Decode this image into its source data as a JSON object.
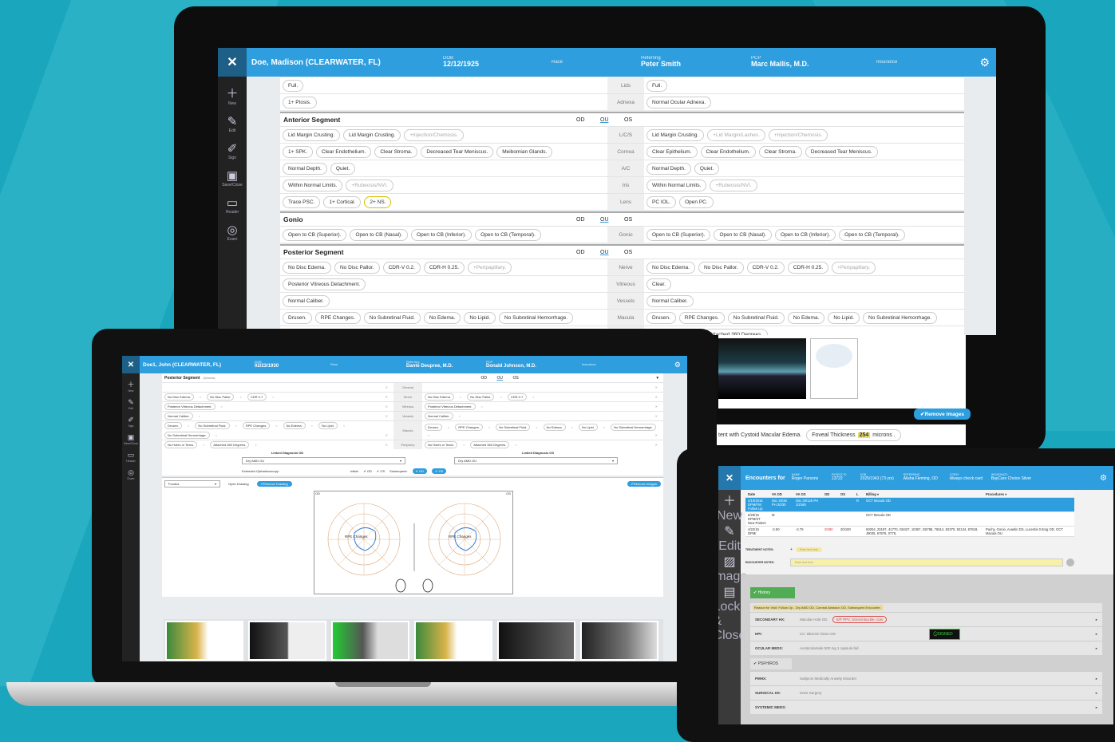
{
  "monitor": {
    "header": {
      "patient": "Doe, Madison (CLEARWATER, FL)",
      "dob_label": "DOB",
      "dob": "12/12/1925",
      "race_label": "Race",
      "referring_label": "Referring",
      "referring": "Peter Smith",
      "pcp_label": "PCP",
      "pcp": "Marc Mallis, M.D.",
      "insurance_label": "Insurance"
    },
    "sidebar": [
      {
        "label": "New",
        "icon": "plus-icon"
      },
      {
        "label": "Edit",
        "icon": "edit-icon"
      },
      {
        "label": "Sign",
        "icon": "pen-icon"
      },
      {
        "label": "Save/Close",
        "icon": "save-close-icon"
      },
      {
        "label": "Header",
        "icon": "monitor-icon"
      },
      {
        "label": "Exam",
        "icon": "compass-icon"
      }
    ],
    "top_rows": [
      {
        "left": [
          "Full."
        ],
        "mid": "Lids",
        "right": [
          "Full."
        ]
      },
      {
        "left": [
          "1+ Ptosis."
        ],
        "mid": "Adnexa",
        "right": [
          "Normal Ocular Adnexa."
        ]
      }
    ],
    "anterior": {
      "title": "Anterior Segment",
      "od": "OD",
      "ou": "OU",
      "os": "OS",
      "rows": [
        {
          "left": [
            "Lid Margin Crusting.",
            "Lid Margin Crusting.",
            "+Injection/Chemosis."
          ],
          "mid": "L/C/S",
          "right": [
            "Lid Margin Crusting.",
            "+Lid Margin/Lashes.",
            "+Injection/Chemosis."
          ]
        },
        {
          "left": [
            "1+ SPK.",
            "Clear Endothelium.",
            "Clear Stroma.",
            "Decreased Tear Meniscus.",
            "Meibomian Glands."
          ],
          "mid": "Cornea",
          "right": [
            "Clear Epithelium.",
            "Clear Endothelium.",
            "Clear Stroma.",
            "Decreased Tear Meniscus."
          ]
        },
        {
          "left": [
            "Normal Depth.",
            "Quiet."
          ],
          "mid": "A/C",
          "right": [
            "Normal Depth.",
            "Quiet."
          ]
        },
        {
          "left": [
            "Within Normal Limits.",
            "+Rubeosis/NVI."
          ],
          "mid": "Iris",
          "right": [
            "Within Normal Limits.",
            "+Rubeosis/NVI."
          ]
        },
        {
          "left": [
            "Trace PSC.",
            "1+ Cortical.",
            "2+ NS."
          ],
          "mid": "Lens",
          "right": [
            "PC IOL.",
            "Open PC."
          ]
        }
      ]
    },
    "gonio": {
      "title": "Gonio",
      "od": "OD",
      "ou": "OU",
      "os": "OS",
      "rows": [
        {
          "left": [
            "Open to CB (Superior).",
            "Open to CB (Nasal).",
            "Open to CB (Inferior).",
            "Open to CB (Temporal)."
          ],
          "mid": "Gonio",
          "right": [
            "Open to CB (Superior).",
            "Open to CB (Nasal).",
            "Open to CB (Inferior).",
            "Open to CB (Temporal)."
          ]
        }
      ]
    },
    "posterior": {
      "title": "Posterior Segment",
      "od": "OD",
      "ou": "OU",
      "os": "OS",
      "rows": [
        {
          "left": [
            "No Disc Edema.",
            "No Disc Pallor.",
            "CDR-V 0.2.",
            "CDR-H 0.25.",
            "+Peripapillary."
          ],
          "mid": "Nerve",
          "right": [
            "No Disc Edema.",
            "No Disc Pallor.",
            "CDR-V 0.2.",
            "CDR-H 0.25.",
            "+Peripapillary."
          ]
        },
        {
          "left": [
            "Posterior Vitreous Detachment."
          ],
          "mid": "Vitreous",
          "right": [
            "Clear."
          ]
        },
        {
          "left": [
            "Normal Caliber."
          ],
          "mid": "Vessels",
          "right": [
            "Normal Caliber."
          ]
        },
        {
          "left": [
            "Drusen.",
            "RPE Changes.",
            "No Subretinal Fluid.",
            "No Edema.",
            "No Lipid.",
            "No Subretinal Hemorrhage."
          ],
          "mid": "Macula",
          "right": [
            "Drusen.",
            "RPE Changes.",
            "No Subretinal Fluid.",
            "No Edema.",
            "No Lipid.",
            "No Subretinal Hemorrhage."
          ]
        },
        {
          "left": [
            "No Holes or Tears.",
            "Attached 360 Degrees."
          ],
          "mid": "Periphery",
          "right": [
            "No Holes or Tears.",
            "Attached 360 Degrees."
          ]
        }
      ]
    },
    "remove_images": "✔Remove Images",
    "diagnosis_text": "tent with Cystoid Macular Edema.",
    "foveal_label": "Foveal Thickness",
    "foveal_value": "254",
    "foveal_unit": "microns ."
  },
  "laptop": {
    "header": {
      "patient": "Doe1, John (CLEARWATER, FL)",
      "dob_label": "DOB",
      "dob": "02/23/1930",
      "race_label": "Race",
      "referring_label": "Referring",
      "referring": "Dante Deupree, M.D.",
      "pcp_label": "PCP",
      "pcp": "Donald Johnson, M.D.",
      "insurance_label": "Insurance"
    },
    "sidebar": [
      {
        "label": "New",
        "icon": "plus-icon"
      },
      {
        "label": "Edit",
        "icon": "edit-icon"
      },
      {
        "label": "Sign",
        "icon": "pen-icon"
      },
      {
        "label": "Save/Close",
        "icon": "save-close-icon"
      },
      {
        "label": "Header",
        "icon": "monitor-icon"
      },
      {
        "label": "Exam",
        "icon": "compass-icon"
      }
    ],
    "posterior": {
      "title": "Posterior Segment",
      "defaults": "(Defaults)",
      "od": "OD",
      "ou": "OU",
      "os": "OS",
      "rows": [
        {
          "left": [],
          "mid": "General",
          "right": []
        },
        {
          "left": [
            "No Disc Edema.",
            "No Disc Pallor.",
            "CDR 0.7."
          ],
          "mid": "Nerve",
          "right": [
            "No Disc Edema.",
            "No Disc Pallor.",
            "CDR 0.7."
          ]
        },
        {
          "left": [
            "Posterior Vitreous Detachment."
          ],
          "mid": "Vitreous",
          "right": [
            "Posterior Vitreous Detachment."
          ]
        },
        {
          "left": [
            "Normal Caliber."
          ],
          "mid": "Vessels",
          "right": [
            "Normal Caliber."
          ]
        },
        {
          "left": [
            "Drusen.",
            "No Subretinal Fluid.",
            "RPE Changes.",
            "No Edema.",
            "No Lipid.",
            "No Subretinal Hemorrhage."
          ],
          "mid": "Macula",
          "right": [
            "Drusen.",
            "RPE Changes.",
            "No Subretinal Fluid.",
            "No Edema.",
            "No Lipid.",
            "No Subretinal Hemorrhage."
          ]
        },
        {
          "left": [
            "No Holes or Tears.",
            "Attached 360 Degrees."
          ],
          "mid": "Periphery",
          "right": [
            "No Holes or Tears.",
            "Attached 360 Degrees."
          ]
        }
      ]
    },
    "linked_od_label": "Linked Diagnosis OD",
    "linked_os_label": "Linked Diagnosis OS",
    "linked_od": "Dry AMD OU",
    "linked_os": "Dry AMD OU",
    "extended_label": "Extended Opthalmoscopy:",
    "initial_label": "Initial:",
    "initial_od": "✔ OD",
    "initial_os": "✔ OS",
    "subsequent_label": "Subsequent:",
    "sub_od": "✔ OD",
    "sub_os": "✔ OS",
    "drawing_select": "Fundus",
    "open_drawing": "Open Drawing",
    "remove_drawing": "✔Remove Drawing",
    "remove_images": "✔Remove Images",
    "od_tag": "OD",
    "os_tag": "OS",
    "annot_od": "RPE Changes",
    "annot_os": "RPE Changes"
  },
  "tablet": {
    "header": {
      "title": "Encounters for",
      "name_label": "NAME",
      "name": "Roger Parsons",
      "pid_label": "PATIENT ID",
      "pid": "13722",
      "dob_label": "DOB",
      "dob": "2025/1943 (73 yrs)",
      "ref_label": "REFERRING",
      "ref": "Alisha Fleming, OD",
      "copay_label": "COPAY",
      "copay": "Always check card",
      "ins_label": "INSURANCE",
      "ins": "BayCare Choice Silver"
    },
    "sidebar": [
      {
        "label": "New",
        "icon": "plus-icon"
      },
      {
        "label": "Edit",
        "icon": "edit-icon"
      },
      {
        "label": "Image",
        "icon": "image-icon"
      },
      {
        "label": "Lock & Close",
        "icon": "lock-icon"
      }
    ],
    "columns": [
      "Date",
      "VA OD",
      "VA OS",
      "OD",
      "OS",
      "L",
      "Billing ▾",
      "Procedures ▾"
    ],
    "rows": [
      {
        "date": "4/10/2015 DPM/FW Follow Up",
        "va_od": "Dsc 20/30 PH 20/30",
        "va_os": "Dsc 20/125 PH 10/160",
        "od": "",
        "os": "",
        "l": "R",
        "billing": "OCT Macula OD",
        "proc": ""
      },
      {
        "date": "5/29/15 DPM/ST New Patient",
        "va_od": "M",
        "va_os": "",
        "od": "",
        "os": "",
        "l": "",
        "billing": "OCT Macula OD",
        "proc": ""
      },
      {
        "date": "4/22/15 DPM/",
        "va_od": "-2.50",
        "va_os": "-2.75",
        "od": "20/80",
        "os": "20/100",
        "l": "",
        "billing": "92004, 20197, 41770, G8427, 10367, G8785, 76514, 92370, 92134, 67818, J9035, 67876, 0778,",
        "proc": "Pachy, Gonio, Avastin DS, Lucentis 0.5mg OD, OCT Macula OU"
      }
    ],
    "treatment_label": "TREATMENT NOTES:",
    "treatment_placeholder": "Enter text here",
    "encounter_label": "ENCOUNTER NOTES:",
    "encounter_placeholder": "Enter text here",
    "history": "✔ History",
    "reason": "Reason for Visit: Follow Up - Dry AMD OD, Corneal Abrasion OD, Subsequent Encounter.",
    "signed": "⃠ SIGNED",
    "acc": [
      {
        "k": "SECONDARY HX:",
        "v": "Macular Hole OD",
        "extra": "S/P PPV, Scleral Buckle, Gas"
      },
      {
        "k": "HPI:",
        "v": "CC: Blurred Vision OD"
      },
      {
        "k": "OCULAR MEDS:",
        "v": "Acetazolamide 500 mg 1 capsule bid"
      }
    ],
    "psfh": "✔ PSFH/ROS",
    "acc2": [
      {
        "k": "PMHX:",
        "v": "Subjects Medically Anxiety Disorder"
      },
      {
        "k": "SURGICAL HX:",
        "v": "Knee Surgery"
      },
      {
        "k": "SYSTEMIC MEDS:",
        "v": ""
      }
    ],
    "colors": {
      "accent": "#2e9ede",
      "green": "#49a94c",
      "select": "#2e9ede"
    }
  }
}
